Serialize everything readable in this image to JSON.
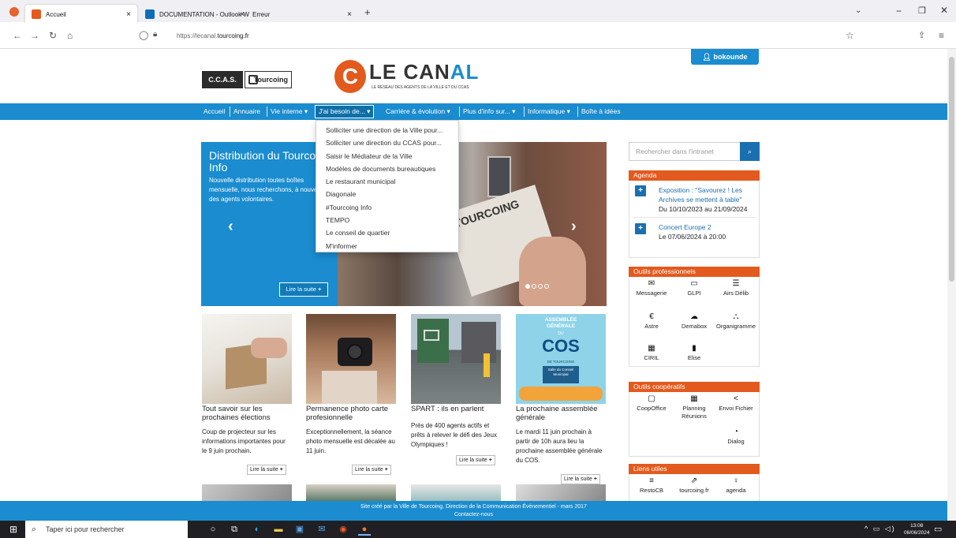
{
  "browser": {
    "tabs": [
      {
        "title": "Accueil",
        "close": "×"
      },
      {
        "title": "DOCUMENTATION - Outlook W",
        "close": "×"
      },
      {
        "title": "Erreur",
        "close": "×"
      }
    ],
    "new_tab": "+",
    "url_plain": "https://lecanal.",
    "url_bold": "tourcoing.fr"
  },
  "header": {
    "ccas_logo": "C.C.A.S.",
    "tourcoing_logo": "Tourcoing",
    "site_c": "C",
    "site_name_1": "LE CAN",
    "site_name_2": "AL",
    "site_tagline": "LE RÉSEAU DES AGENTS DE LA VILLE ET DU CCAS",
    "user": "bokounde"
  },
  "nav": {
    "items": [
      "Accueil",
      "Annuaire",
      "Vie interne ▾",
      "J'ai besoin de... ▾",
      "Carrière & évolution ▾",
      "Plus d'info sur... ▾",
      "Informatique ▾",
      "Boîte à idées"
    ],
    "dropdown": [
      "Solliciter une direction de la Ville pour...",
      "Solliciter une direction du CCAS pour...",
      "Saisir le Médiateur de la Ville",
      "Modèles de documents bureautiques",
      "Le restaurant municipal",
      "Diagonale",
      "#Tourcoing Info",
      "TEMPO",
      "Le conseil de quartier",
      "M'informer"
    ]
  },
  "slider": {
    "title": "Distribution du Tourcoing Info",
    "desc": "Nouvelle distribution toutes boîtes mensuelle, nous recherchons, à nouveau, des agents volontaires.",
    "more": "Lire la suite",
    "prev": "‹",
    "next": "›",
    "paper_text": "TOURCOING"
  },
  "news": [
    {
      "title": "Tout savoir sur les prochaines élections",
      "text": "Coup de projecteur sur les informations importantes pour le 9 juin prochain.",
      "more": "Lire la suite"
    },
    {
      "title": "Permanence photo carte profesionnelle",
      "text": "Exceptionnellement, la séance photo mensuelle est décalée au 11 juin.",
      "more": "Lire la suite"
    },
    {
      "title": "SPART : ils en parlent",
      "text": "Près de 400 agents actifs et prêts à relever le défi des Jeux Olympiques !",
      "more": "Lire la suite"
    },
    {
      "title": "La prochaine assemblée générale",
      "text": "Le mardi 11 juin prochain à partir de 10h aura lieu la prochaine assemblée générale du COS.",
      "more": "Lire la suite",
      "poster": [
        "ASSEMBLÉE GÉNÉRALE",
        "DU",
        "COS",
        "DE TOURCOING",
        "Salle du Conseil Municipal"
      ]
    }
  ],
  "sidebar": {
    "search_placeholder": "Rechercher dans l'intranet",
    "agenda_title": "Agenda",
    "events": [
      {
        "title": "Exposition : \"Savourez ! Les Archives se mettent à table\"",
        "date": "Du 10/10/2023 au 21/09/2024"
      },
      {
        "title": "Concert Europe 2",
        "date": "Le 07/06/2024 à 20:00"
      }
    ],
    "pro_title": "Outils professionnels",
    "pro_tools": [
      {
        "label": "Messagerie",
        "icon": "envelope-icon",
        "glyph": "✉"
      },
      {
        "label": "GLPI",
        "icon": "monitor-icon",
        "glyph": "▭"
      },
      {
        "label": "Airs Délib",
        "icon": "list-icon",
        "glyph": "☰"
      },
      {
        "label": "Astre",
        "icon": "euro-icon",
        "glyph": "€"
      },
      {
        "label": "Demabox",
        "icon": "cloud-icon",
        "glyph": "☁"
      },
      {
        "label": "Organigramme",
        "icon": "sitemap-icon",
        "glyph": "⛬"
      },
      {
        "label": "CIRIL",
        "icon": "calendar-icon",
        "glyph": "▦"
      },
      {
        "label": "Elise",
        "icon": "file-icon",
        "glyph": "▮"
      }
    ],
    "coop_title": "Outils coopératifs",
    "coop_tools": [
      {
        "label": "CoopOffice",
        "icon": "clipboard-icon",
        "glyph": "▢"
      },
      {
        "label": "Planning Réunions",
        "icon": "calendar-icon",
        "glyph": "▦"
      },
      {
        "label": "Envoi Fichier",
        "icon": "share-icon",
        "glyph": "<"
      },
      {
        "label": "Dialog",
        "icon": "chat-icon",
        "glyph": "◔"
      }
    ],
    "links_title": "Liens utiles",
    "links": [
      {
        "label": "RestoCB",
        "icon": "bars-icon",
        "glyph": "≡"
      },
      {
        "label": "tourcoing.fr",
        "icon": "external-link-icon",
        "glyph": "⇗"
      },
      {
        "label": "agenda",
        "icon": "bulb-icon",
        "glyph": "♀"
      }
    ]
  },
  "footer": {
    "line1": "Site créé par la Ville de Tourcoing, Direction de la Communication Événementiel - mars 2017",
    "line2": "Contactez-nous"
  },
  "taskbar": {
    "search": "Taper ici pour rechercher",
    "time": "13:08",
    "date": "06/06/2024"
  },
  "colors": {
    "brand_blue": "#1a8ccf",
    "brand_orange": "#e35a1e"
  }
}
